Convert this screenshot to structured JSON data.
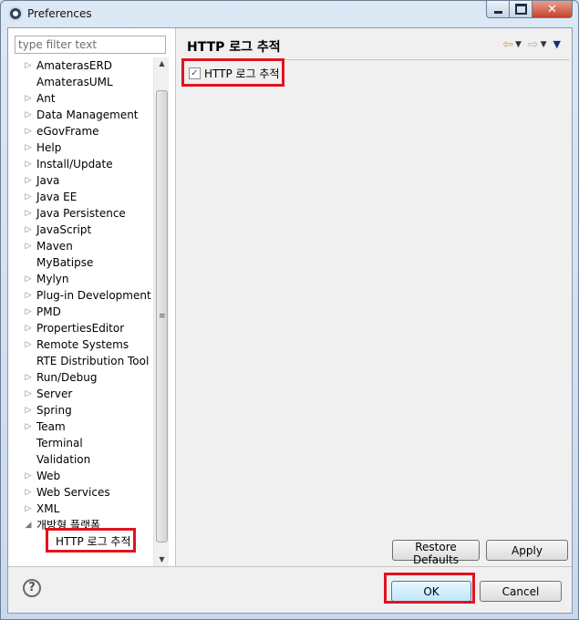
{
  "window": {
    "title": "Preferences"
  },
  "filter": {
    "placeholder": "type filter text",
    "value": ""
  },
  "tree": {
    "items": [
      {
        "label": "AmaterasERD",
        "expandable": true
      },
      {
        "label": "AmaterasUML",
        "expandable": false
      },
      {
        "label": "Ant",
        "expandable": true
      },
      {
        "label": "Data Management",
        "expandable": true
      },
      {
        "label": "eGovFrame",
        "expandable": true
      },
      {
        "label": "Help",
        "expandable": true
      },
      {
        "label": "Install/Update",
        "expandable": true
      },
      {
        "label": "Java",
        "expandable": true
      },
      {
        "label": "Java EE",
        "expandable": true
      },
      {
        "label": "Java Persistence",
        "expandable": true
      },
      {
        "label": "JavaScript",
        "expandable": true
      },
      {
        "label": "Maven",
        "expandable": true
      },
      {
        "label": "MyBatipse",
        "expandable": false
      },
      {
        "label": "Mylyn",
        "expandable": true
      },
      {
        "label": "Plug-in Development",
        "expandable": true
      },
      {
        "label": "PMD",
        "expandable": true
      },
      {
        "label": "PropertiesEditor",
        "expandable": true
      },
      {
        "label": "Remote Systems",
        "expandable": true
      },
      {
        "label": "RTE Distribution Tool",
        "expandable": false
      },
      {
        "label": "Run/Debug",
        "expandable": true
      },
      {
        "label": "Server",
        "expandable": true
      },
      {
        "label": "Spring",
        "expandable": true
      },
      {
        "label": "Team",
        "expandable": true
      },
      {
        "label": "Terminal",
        "expandable": false
      },
      {
        "label": "Validation",
        "expandable": false
      },
      {
        "label": "Web",
        "expandable": true
      },
      {
        "label": "Web Services",
        "expandable": true
      },
      {
        "label": "XML",
        "expandable": true
      },
      {
        "label": "개방형 플랫폼",
        "expandable": true,
        "expanded": true
      },
      {
        "label": "HTTP 로그 추적",
        "child": true,
        "selected": true
      }
    ]
  },
  "page": {
    "title": "HTTP 로그 추적",
    "option_label": "HTTP 로그 추적",
    "option_checked": true,
    "restore_defaults": "Restore Defaults",
    "apply": "Apply"
  },
  "dialog": {
    "ok": "OK",
    "cancel": "Cancel"
  },
  "icons": {
    "help": "help-icon",
    "back": "back-arrow-icon",
    "forward": "forward-arrow-icon",
    "view_menu": "view-menu-icon"
  },
  "colors": {
    "highlight": "#e0141e",
    "ok_focus": "#3c7fb1"
  }
}
